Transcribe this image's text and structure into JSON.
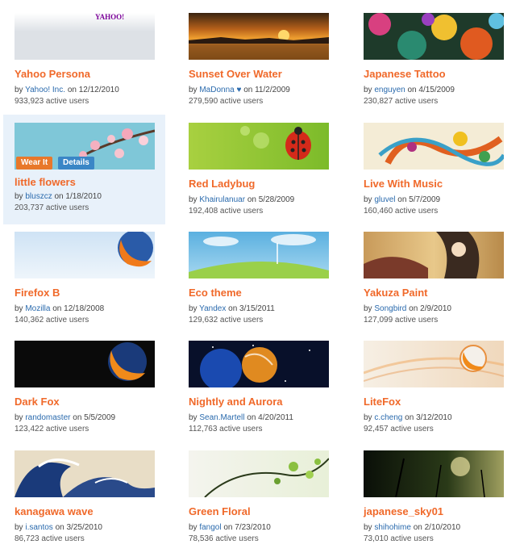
{
  "themes": [
    {
      "title": "Yahoo Persona",
      "author": "Yahoo! Inc.",
      "date": "12/12/2010",
      "users": "933,923 active users",
      "thumb_text": "YAHOO!"
    },
    {
      "title": "Sunset Over Water",
      "author": "MaDonna ♥",
      "date": "11/2/2009",
      "users": "279,590 active users"
    },
    {
      "title": "Japanese Tattoo",
      "author": "enguyen",
      "date": "4/15/2009",
      "users": "230,827 active users"
    },
    {
      "title": "little flowers",
      "author": "bluszcz",
      "date": "1/18/2010",
      "users": "203,737 active users",
      "wear_label": "Wear It",
      "details_label": "Details"
    },
    {
      "title": "Red Ladybug",
      "author": "Khairulanuar",
      "date": "5/28/2009",
      "users": "192,408 active users"
    },
    {
      "title": "Live With Music",
      "author": "gluvel",
      "date": "5/7/2009",
      "users": "160,460 active users"
    },
    {
      "title": "Firefox B",
      "author": "Mozilla",
      "date": "12/18/2008",
      "users": "140,362 active users"
    },
    {
      "title": "Eco theme",
      "author": "Yandex",
      "date": "3/15/2011",
      "users": "129,632 active users"
    },
    {
      "title": "Yakuza Paint",
      "author": "Songbird",
      "date": "2/9/2010",
      "users": "127,099 active users"
    },
    {
      "title": "Dark Fox",
      "author": "randomaster",
      "date": "5/5/2009",
      "users": "123,422 active users"
    },
    {
      "title": "Nightly and Aurora",
      "author": "Sean.Martell",
      "date": "4/20/2011",
      "users": "112,763 active users"
    },
    {
      "title": "LiteFox",
      "author": "c.cheng",
      "date": "3/12/2010",
      "users": "92,457 active users"
    },
    {
      "title": "kanagawa wave",
      "author": "i.santos",
      "date": "3/25/2010",
      "users": "86,723 active users"
    },
    {
      "title": "Green Floral",
      "author": "fangol",
      "date": "7/23/2010",
      "users": "78,536 active users"
    },
    {
      "title": "japanese_sky01",
      "author": "shihohime",
      "date": "2/10/2010",
      "users": "73,010 active users"
    }
  ],
  "labels": {
    "by": "by",
    "on": "on"
  }
}
